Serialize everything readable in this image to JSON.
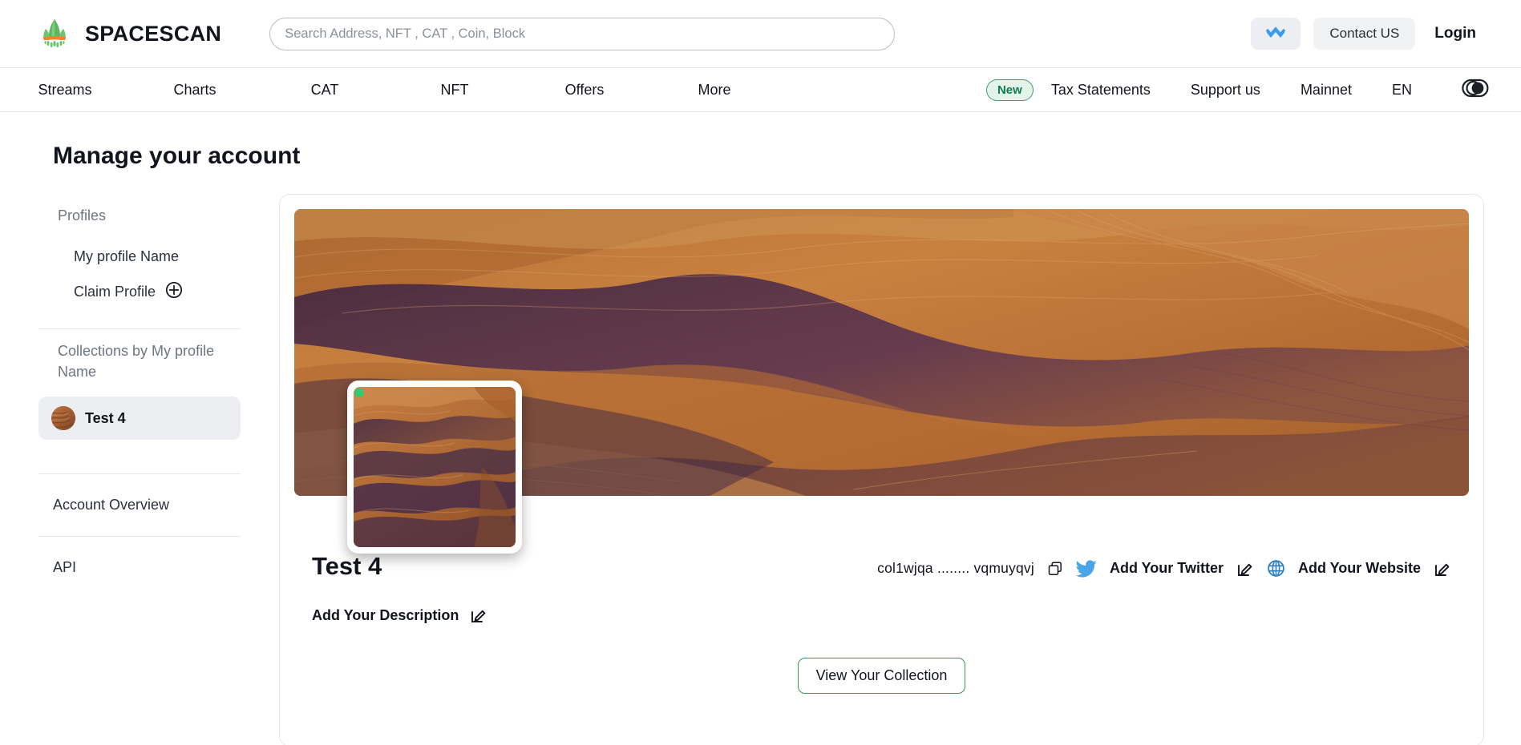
{
  "header": {
    "brand_name": "SPACESCAN",
    "logo_icon": "rocket-logo-icon",
    "search": {
      "placeholder": "Search Address, NFT , CAT , Coin, Block",
      "value": ""
    },
    "wallet_icon": "wallet-connect-icon",
    "contact_label": "Contact US",
    "login_label": "Login"
  },
  "nav": {
    "left_items": [
      {
        "label": "Streams"
      },
      {
        "label": "Charts"
      },
      {
        "label": "CAT"
      },
      {
        "label": "NFT"
      },
      {
        "label": "Offers"
      },
      {
        "label": "More"
      }
    ],
    "new_badge": "New",
    "right_items": [
      {
        "label": "Tax Statements"
      },
      {
        "label": "Support us"
      },
      {
        "label": "Mainnet"
      },
      {
        "label": "EN"
      }
    ],
    "mode_toggle_icon": "dark-mode-toggle-icon"
  },
  "page": {
    "title": "Manage your account"
  },
  "sidebar": {
    "profiles_heading": "Profiles",
    "profile_items": [
      {
        "label": "My profile Name",
        "icon": null
      },
      {
        "label": "Claim Profile",
        "icon": "plus-circle-icon"
      }
    ],
    "collections_heading": "Collections by My profile Name",
    "collections": [
      {
        "label": "Test 4",
        "avatar": "collection-avatar",
        "selected": true
      }
    ],
    "links": [
      {
        "label": "Account Overview"
      },
      {
        "label": "API"
      }
    ]
  },
  "profile": {
    "banner_image": "desert-dunes-banner",
    "avatar_image": "desert-dunes-avatar",
    "name": "Test 4",
    "address": "col1wjqa ........ vqmuyqvj",
    "copy_icon": "copy-icon",
    "twitter_icon": "twitter-icon",
    "twitter_label": "Add Your Twitter",
    "twitter_edit_icon": "edit-pencil-icon",
    "website_icon": "globe-icon",
    "website_label": "Add Your Website",
    "website_edit_icon": "edit-pencil-icon",
    "description_label": "Add Your Description",
    "description_edit_icon": "edit-pencil-icon",
    "cta_label": "View Your Collection"
  },
  "colors": {
    "brand_green": "#4caf50",
    "accent_blue": "#3b9bf0",
    "badge_green": "#0f7a4e",
    "cta_border_green": "#2aa05c",
    "sand_orange": "#c87b3e",
    "sand_shadow": "#4a3050"
  }
}
